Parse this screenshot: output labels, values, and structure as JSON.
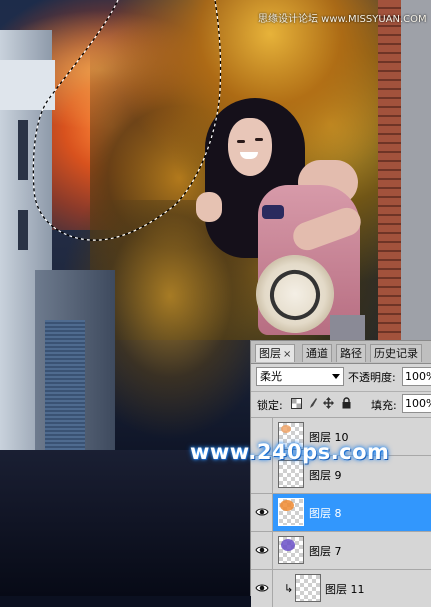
{
  "watermark": "思缘设计论坛 www.MISSYUAN.COM",
  "site_mark": "www.240ps.com",
  "layers_panel": {
    "tabs": [
      {
        "label": "图层",
        "close": "×"
      },
      {
        "label": "通道"
      },
      {
        "label": "路径"
      },
      {
        "label": "历史记录"
      }
    ],
    "blend_mode": "柔光",
    "opacity_label": "不透明度:",
    "opacity_value": "100%",
    "lock_label": "锁定:",
    "fill_label": "填充:",
    "fill_value": "100%",
    "layers": [
      {
        "name": "图层 10",
        "visible": false,
        "selected": false,
        "thumb_color": "#f0a060"
      },
      {
        "name": "图层 9",
        "visible": false,
        "selected": false,
        "thumb_color": ""
      },
      {
        "name": "图层 8",
        "visible": true,
        "selected": true,
        "thumb_color": "#f08a30"
      },
      {
        "name": "图层 7",
        "visible": true,
        "selected": false,
        "thumb_color": "#6a50c8"
      },
      {
        "name": "图层 11",
        "visible": true,
        "selected": false,
        "thumb_color": "",
        "clipped": true
      }
    ]
  },
  "colors": {
    "selection_highlight": "#3297fd",
    "panel_bg": "#d6d6d6"
  }
}
